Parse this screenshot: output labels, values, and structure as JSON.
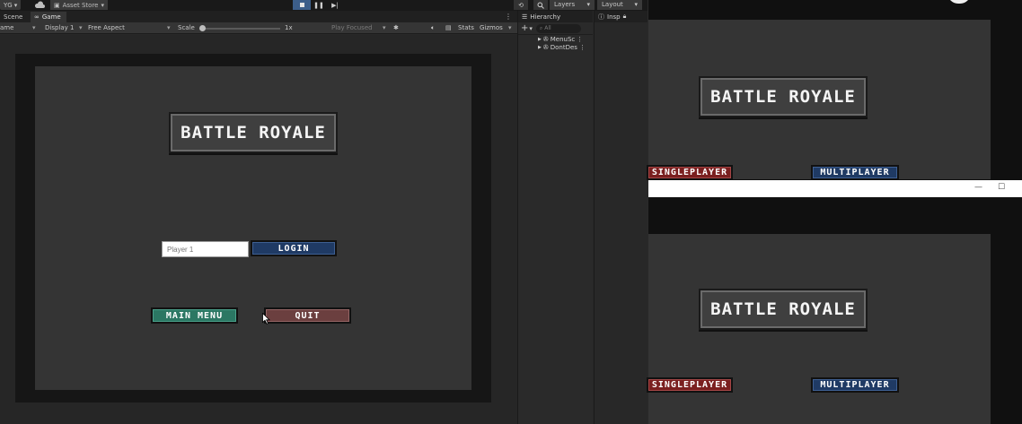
{
  "toolbar": {
    "account": "YG",
    "asset_store": "Asset Store",
    "layers": "Layers",
    "layout": "Layout"
  },
  "tabs": {
    "scene": "Scene",
    "game": "Game"
  },
  "gamebar": {
    "mode": "ame",
    "display": "Display 1",
    "aspect": "Free Aspect",
    "scale_label": "Scale",
    "scale_value": "1x",
    "play_focused": "Play Focused",
    "stats": "Stats",
    "gizmos": "Gizmos"
  },
  "hierarchy": {
    "title": "Hierarchy",
    "search_placeholder": "All",
    "items": [
      "MenuSc",
      "DontDes"
    ]
  },
  "inspector": {
    "title": "Insp"
  },
  "game": {
    "title": "BATTLE ROYALE",
    "name_placeholder": "Player 1",
    "login": "LOGIN",
    "main_menu": "MAIN MENU",
    "quit": "QUIT"
  },
  "build_top": {
    "title": "BATTLE ROYALE",
    "singleplayer": "SINGLEPLAYER",
    "multiplayer": "MULTIPLAYER"
  },
  "window_controls": {
    "minimize": "—",
    "maximize": "☐"
  },
  "build_bottom": {
    "title": "BATTLE ROYALE",
    "singleplayer": "SINGLEPLAYER",
    "multiplayer": "MULTIPLAYER"
  }
}
